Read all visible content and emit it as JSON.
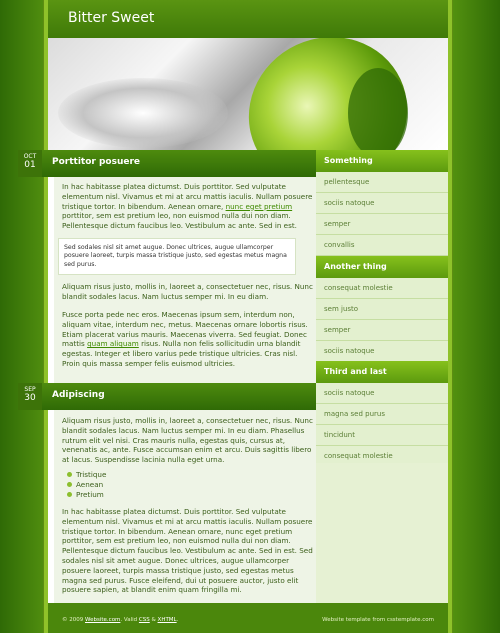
{
  "header": {
    "site_title": "Bitter Sweet"
  },
  "posts": [
    {
      "month": "OCT",
      "day": "01",
      "title": "Porttitor posuere",
      "p1_a": "In hac habitasse platea dictumst. Duis porttitor. Sed vulputate elementum nisl. Vivamus et mi at arcu mattis iaculis. Nullam posuere tristique tortor. In bibendum. Aenean ornare, ",
      "p1_link": "nunc eget pretium",
      "p1_b": " porttitor, sem est pretium leo, non euismod nulla dui non diam. Pellentesque dictum faucibus leo. Vestibulum ac ante. Sed in est.",
      "quote": "Sed sodales nisl sit amet augue. Donec ultrices, augue ullamcorper posuere laoreet, turpis massa tristique justo, sed egestas metus magna sed purus.",
      "p2": "Aliquam risus justo, mollis in, laoreet a, consectetuer nec, risus. Nunc blandit sodales lacus. Nam luctus semper mi. In eu diam.",
      "p3_a": "Fusce porta pede nec eros. Maecenas ipsum sem, interdum non, aliquam vitae, interdum nec, metus. Maecenas ornare lobortis risus. Etiam placerat varius mauris. Maecenas viverra. Sed feugiat. Donec mattis ",
      "p3_link": "quam aliquam",
      "p3_b": " risus. Nulla non felis sollicitudin urna blandit egestas. Integer et libero varius pede tristique ultricies. Cras nisl. Proin quis massa semper felis euismod ultricies."
    },
    {
      "month": "SEP",
      "day": "30",
      "title": "Adipiscing",
      "p1": "Aliquam risus justo, mollis in, laoreet a, consectetuer nec, risus. Nunc blandit sodales lacus. Nam luctus semper mi. In eu diam. Phasellus rutrum elit vel nisi. Cras mauris nulla, egestas quis, cursus at, venenatis ac, ante. Fusce accumsan enim et arcu. Duis sagittis libero at lacus. Suspendisse lacinia nulla eget urna.",
      "bullets": [
        "Tristique",
        "Aenean",
        "Pretium"
      ],
      "p2": "In hac habitasse platea dictumst. Duis porttitor. Sed vulputate elementum nisl. Vivamus et mi at arcu mattis iaculis. Nullam posuere tristique tortor. In bibendum. Aenean ornare, nunc eget pretium porttitor, sem est pretium leo, non euismod nulla dui non diam. Pellentesque dictum faucibus leo. Vestibulum ac ante. Sed in est. Sed sodales nisl sit amet augue. Donec ultrices, augue ullamcorper posuere laoreet, turpis massa tristique justo, sed egestas metus magna sed purus. Fusce eleifend, dui ut posuere auctor, justo elit posuere sapien, at blandit enim quam fringilla mi."
    }
  ],
  "sidebar": {
    "sections": [
      {
        "title": "Something",
        "items": [
          "pellentesque",
          "sociis natoque",
          "semper",
          "convallis"
        ]
      },
      {
        "title": "Another thing",
        "items": [
          "consequat molestie",
          "sem justo",
          "semper",
          "sociis natoque"
        ]
      },
      {
        "title": "Third and last",
        "items": [
          "sociis natoque",
          "magna sed purus",
          "tincidunt",
          "consequat molestie"
        ]
      }
    ]
  },
  "footer": {
    "copy": "© 2009 ",
    "site_link": "Website.com",
    "sep1": ". Valid ",
    "css": "CSS",
    "amp": " & ",
    "xhtml": "XHTML",
    "sep2": ".",
    "right": "Website template from csstemplate.com"
  },
  "colors": {
    "accent": "#4b870c",
    "sidebar_header": "#6fac14",
    "text": "#3b5e1a"
  }
}
